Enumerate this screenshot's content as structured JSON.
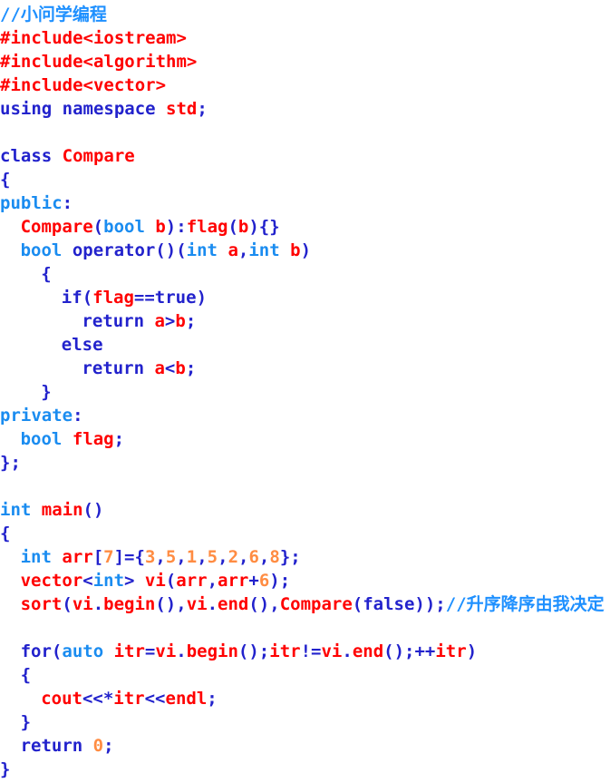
{
  "editor": {
    "title": "C++ source code",
    "language": "cpp",
    "background": "#ffffff",
    "font_weight": "bold",
    "colors": {
      "comment": "#1e90ff",
      "preprocessor": "#ff0000",
      "keyword": "#2222cc",
      "type_keyword": "#1a8cf0",
      "identifier": "#ff0000",
      "punctuation": "#2222cc",
      "number": "#ff8c42"
    }
  },
  "code": {
    "lines": [
      {
        "indent": 0,
        "tokens": [
          {
            "t": "//小问学编程",
            "c": "comment"
          }
        ]
      },
      {
        "indent": 0,
        "tokens": [
          {
            "t": "#include<iostream>",
            "c": "pre"
          }
        ]
      },
      {
        "indent": 0,
        "tokens": [
          {
            "t": "#include<algorithm>",
            "c": "pre"
          }
        ]
      },
      {
        "indent": 0,
        "tokens": [
          {
            "t": "#include<vector>",
            "c": "pre"
          }
        ]
      },
      {
        "indent": 0,
        "tokens": [
          {
            "t": "using namespace ",
            "c": "kw"
          },
          {
            "t": "std",
            "c": "ident"
          },
          {
            "t": ";",
            "c": "punc"
          }
        ]
      },
      {
        "indent": 0,
        "tokens": []
      },
      {
        "indent": 0,
        "tokens": [
          {
            "t": "class ",
            "c": "kw"
          },
          {
            "t": "Compare",
            "c": "ident"
          }
        ]
      },
      {
        "indent": 0,
        "tokens": [
          {
            "t": "{",
            "c": "punc"
          }
        ]
      },
      {
        "indent": 0,
        "tokens": [
          {
            "t": "public",
            "c": "type"
          },
          {
            "t": ":",
            "c": "punc"
          }
        ]
      },
      {
        "indent": 1,
        "tokens": [
          {
            "t": "Compare",
            "c": "ident"
          },
          {
            "t": "(",
            "c": "punc"
          },
          {
            "t": "bool",
            "c": "type"
          },
          {
            "t": " ",
            "c": "punc"
          },
          {
            "t": "b",
            "c": "ident"
          },
          {
            "t": "):",
            "c": "punc"
          },
          {
            "t": "flag",
            "c": "ident"
          },
          {
            "t": "(",
            "c": "punc"
          },
          {
            "t": "b",
            "c": "ident"
          },
          {
            "t": "){}",
            "c": "punc"
          }
        ]
      },
      {
        "indent": 1,
        "tokens": [
          {
            "t": "bool",
            "c": "type"
          },
          {
            "t": " ",
            "c": "punc"
          },
          {
            "t": "operator",
            "c": "kw"
          },
          {
            "t": "()(",
            "c": "punc"
          },
          {
            "t": "int",
            "c": "type"
          },
          {
            "t": " ",
            "c": "punc"
          },
          {
            "t": "a",
            "c": "ident"
          },
          {
            "t": ",",
            "c": "punc"
          },
          {
            "t": "int",
            "c": "type"
          },
          {
            "t": " ",
            "c": "punc"
          },
          {
            "t": "b",
            "c": "ident"
          },
          {
            "t": ")",
            "c": "punc"
          }
        ]
      },
      {
        "indent": 2,
        "tokens": [
          {
            "t": "{",
            "c": "punc"
          }
        ]
      },
      {
        "indent": 3,
        "tokens": [
          {
            "t": "if",
            "c": "kw"
          },
          {
            "t": "(",
            "c": "punc"
          },
          {
            "t": "flag",
            "c": "ident"
          },
          {
            "t": "==",
            "c": "punc"
          },
          {
            "t": "true",
            "c": "kw"
          },
          {
            "t": ")",
            "c": "punc"
          }
        ]
      },
      {
        "indent": 4,
        "tokens": [
          {
            "t": "return ",
            "c": "kw"
          },
          {
            "t": "a",
            "c": "ident"
          },
          {
            "t": ">",
            "c": "punc"
          },
          {
            "t": "b",
            "c": "ident"
          },
          {
            "t": ";",
            "c": "punc"
          }
        ]
      },
      {
        "indent": 3,
        "tokens": [
          {
            "t": "else",
            "c": "kw"
          }
        ]
      },
      {
        "indent": 4,
        "tokens": [
          {
            "t": "return ",
            "c": "kw"
          },
          {
            "t": "a",
            "c": "ident"
          },
          {
            "t": "<",
            "c": "punc"
          },
          {
            "t": "b",
            "c": "ident"
          },
          {
            "t": ";",
            "c": "punc"
          }
        ]
      },
      {
        "indent": 2,
        "tokens": [
          {
            "t": "}",
            "c": "punc"
          }
        ]
      },
      {
        "indent": 0,
        "tokens": [
          {
            "t": "private",
            "c": "type"
          },
          {
            "t": ":",
            "c": "punc"
          }
        ]
      },
      {
        "indent": 1,
        "tokens": [
          {
            "t": "bool",
            "c": "type"
          },
          {
            "t": " ",
            "c": "punc"
          },
          {
            "t": "flag",
            "c": "ident"
          },
          {
            "t": ";",
            "c": "punc"
          }
        ]
      },
      {
        "indent": 0,
        "tokens": [
          {
            "t": "};",
            "c": "punc"
          }
        ]
      },
      {
        "indent": 0,
        "tokens": []
      },
      {
        "indent": 0,
        "tokens": [
          {
            "t": "int",
            "c": "type"
          },
          {
            "t": " ",
            "c": "punc"
          },
          {
            "t": "main",
            "c": "ident"
          },
          {
            "t": "()",
            "c": "punc"
          }
        ]
      },
      {
        "indent": 0,
        "tokens": [
          {
            "t": "{",
            "c": "punc"
          }
        ]
      },
      {
        "indent": 1,
        "tokens": [
          {
            "t": "int",
            "c": "type"
          },
          {
            "t": " ",
            "c": "punc"
          },
          {
            "t": "arr",
            "c": "ident"
          },
          {
            "t": "[",
            "c": "punc"
          },
          {
            "t": "7",
            "c": "num"
          },
          {
            "t": "]={",
            "c": "punc"
          },
          {
            "t": "3",
            "c": "num"
          },
          {
            "t": ",",
            "c": "punc"
          },
          {
            "t": "5",
            "c": "num"
          },
          {
            "t": ",",
            "c": "punc"
          },
          {
            "t": "1",
            "c": "num"
          },
          {
            "t": ",",
            "c": "punc"
          },
          {
            "t": "5",
            "c": "num"
          },
          {
            "t": ",",
            "c": "punc"
          },
          {
            "t": "2",
            "c": "num"
          },
          {
            "t": ",",
            "c": "punc"
          },
          {
            "t": "6",
            "c": "num"
          },
          {
            "t": ",",
            "c": "punc"
          },
          {
            "t": "8",
            "c": "num"
          },
          {
            "t": "};",
            "c": "punc"
          }
        ]
      },
      {
        "indent": 1,
        "tokens": [
          {
            "t": "vector",
            "c": "ident"
          },
          {
            "t": "<",
            "c": "punc"
          },
          {
            "t": "int",
            "c": "type"
          },
          {
            "t": "> ",
            "c": "punc"
          },
          {
            "t": "vi",
            "c": "ident"
          },
          {
            "t": "(",
            "c": "punc"
          },
          {
            "t": "arr",
            "c": "ident"
          },
          {
            "t": ",",
            "c": "punc"
          },
          {
            "t": "arr",
            "c": "ident"
          },
          {
            "t": "+",
            "c": "punc"
          },
          {
            "t": "6",
            "c": "num"
          },
          {
            "t": ");",
            "c": "punc"
          }
        ]
      },
      {
        "indent": 1,
        "tokens": [
          {
            "t": "sort",
            "c": "ident"
          },
          {
            "t": "(",
            "c": "punc"
          },
          {
            "t": "vi",
            "c": "ident"
          },
          {
            "t": ".",
            "c": "punc"
          },
          {
            "t": "begin",
            "c": "ident"
          },
          {
            "t": "(),",
            "c": "punc"
          },
          {
            "t": "vi",
            "c": "ident"
          },
          {
            "t": ".",
            "c": "punc"
          },
          {
            "t": "end",
            "c": "ident"
          },
          {
            "t": "(),",
            "c": "punc"
          },
          {
            "t": "Compare",
            "c": "ident"
          },
          {
            "t": "(",
            "c": "punc"
          },
          {
            "t": "false",
            "c": "kw"
          },
          {
            "t": "));",
            "c": "punc"
          },
          {
            "t": "//升序降序由我决定",
            "c": "comment"
          }
        ]
      },
      {
        "indent": 0,
        "tokens": []
      },
      {
        "indent": 1,
        "tokens": [
          {
            "t": "for",
            "c": "kw"
          },
          {
            "t": "(",
            "c": "punc"
          },
          {
            "t": "auto",
            "c": "type"
          },
          {
            "t": " ",
            "c": "punc"
          },
          {
            "t": "itr",
            "c": "ident"
          },
          {
            "t": "=",
            "c": "punc"
          },
          {
            "t": "vi",
            "c": "ident"
          },
          {
            "t": ".",
            "c": "punc"
          },
          {
            "t": "begin",
            "c": "ident"
          },
          {
            "t": "();",
            "c": "punc"
          },
          {
            "t": "itr",
            "c": "ident"
          },
          {
            "t": "!=",
            "c": "punc"
          },
          {
            "t": "vi",
            "c": "ident"
          },
          {
            "t": ".",
            "c": "punc"
          },
          {
            "t": "end",
            "c": "ident"
          },
          {
            "t": "();",
            "c": "punc"
          },
          {
            "t": "++",
            "c": "punc"
          },
          {
            "t": "itr",
            "c": "ident"
          },
          {
            "t": ")",
            "c": "punc"
          }
        ]
      },
      {
        "indent": 1,
        "tokens": [
          {
            "t": "{",
            "c": "punc"
          }
        ]
      },
      {
        "indent": 2,
        "tokens": [
          {
            "t": "cout",
            "c": "ident"
          },
          {
            "t": "<<*",
            "c": "punc"
          },
          {
            "t": "itr",
            "c": "ident"
          },
          {
            "t": "<<",
            "c": "punc"
          },
          {
            "t": "endl",
            "c": "ident"
          },
          {
            "t": ";",
            "c": "punc"
          }
        ]
      },
      {
        "indent": 1,
        "tokens": [
          {
            "t": "}",
            "c": "punc"
          }
        ]
      },
      {
        "indent": 1,
        "tokens": [
          {
            "t": "return ",
            "c": "kw"
          },
          {
            "t": "0",
            "c": "num"
          },
          {
            "t": ";",
            "c": "punc"
          }
        ]
      },
      {
        "indent": 0,
        "tokens": [
          {
            "t": "}",
            "c": "punc"
          }
        ]
      }
    ]
  }
}
